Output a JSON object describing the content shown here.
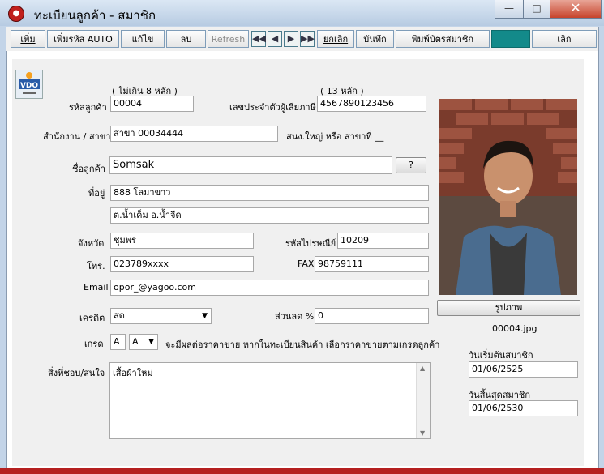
{
  "window": {
    "title": "ทะเบียนลูกค้า - สมาชิก",
    "app_icon": "app-icon",
    "controls": {
      "minimize": "—",
      "maximize": "□",
      "close": "✕"
    }
  },
  "toolbar": {
    "add": "เพิ่ม",
    "add_auto": "เพิ่มรหัส AUTO",
    "edit": "แก้ไข",
    "delete": "ลบ",
    "refresh": "Refresh",
    "nav_first": "◀◀",
    "nav_prev": "◀",
    "nav_next": "▶",
    "nav_last": "▶▶",
    "cancel": "ยกเลิก",
    "save": "บันทึก",
    "print_card": "พิมพ์บัตรสมาชิก",
    "exit": "เลิก"
  },
  "form": {
    "logo_text": "VDO",
    "customer_code_hint": "( ไม่เกิน 8 หลัก )",
    "customer_code_label": "รหัสลูกค้า",
    "customer_code": "00004",
    "tax_id_hint": "( 13 หลัก )",
    "tax_id_label": "เลขประจำตัวผู้เสียภาษี",
    "tax_id": "4567890123456",
    "branch_label": "สำนักงาน / สาขา",
    "branch": "สาขา 00034444",
    "branch_note": "สนง.ใหญ่ หรือ สาขาที่ __",
    "name_label": "ชื่อลูกค้า",
    "name": "Somsak",
    "name_help": "?",
    "address_label": "ที่อยู่",
    "address1": "888 โลมาขาว",
    "address2": "ต.น้ำเค็ม  อ.น้ำจืด",
    "province_label": "จังหวัด",
    "province": "ชุมพร",
    "postcode_label": "รหัสไปรษณีย์",
    "postcode": "10209",
    "phone_label": "โทร.",
    "phone": "023789xxxx",
    "fax_label": "FAX",
    "fax": "98759111",
    "email_label": "Email",
    "email": "opor_@yagoo.com",
    "credit_label": "เครดิต",
    "credit": "สด",
    "discount_label": "ส่วนลด %",
    "discount": "0",
    "grade_label": "เกรด",
    "grade_value": "A",
    "grade_select": "A",
    "grade_note": "จะมีผลต่อราคาขาย  หากในทะเบียนสินค้า เลือกราคาขายตามเกรดลูกค้า",
    "interest_label": "สิ่งที่ชอบ/สนใจ",
    "interest": "เสื้อผ้าใหม่"
  },
  "photo": {
    "button": "รูปภาพ",
    "filename": "00004.jpg"
  },
  "membership": {
    "start_label": "วันเริ่มต้นสมาชิก",
    "start": "01/06/2525",
    "end_label": "วันสิ้นสุดสมาชิก",
    "end": "01/06/2530"
  },
  "colors": {
    "accent": "#138a8a",
    "title_bg": "#c3d4e8",
    "close": "#c7442c"
  }
}
